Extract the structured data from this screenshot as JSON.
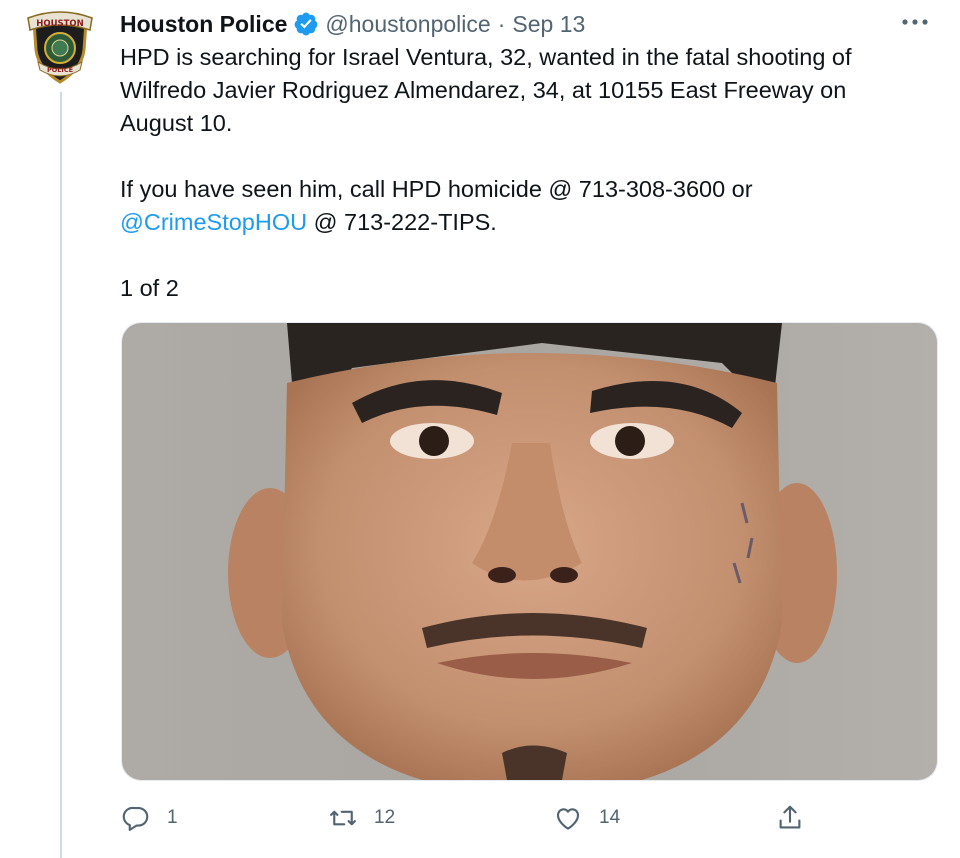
{
  "account": {
    "display_name": "Houston Police",
    "handle": "@houstonpolice",
    "separator": "·",
    "date": "Sep 13",
    "avatar_badge_top": "HOUSTON",
    "avatar_badge_bottom": "POLICE"
  },
  "tweet": {
    "line_1": "HPD is searching for Israel Ventura, 32, wanted in the fatal shooting of",
    "line_2": "Wilfredo Javier Rodriguez Almendarez, 34, at 10155 East Freeway on",
    "line_3": "August 10.",
    "line_4_prefix": "If you have seen him, call HPD homicide @ 713-308-3600 or",
    "mention": "@CrimeStopHOU",
    "line_5_suffix": " @ 713-222-TIPS.",
    "thread_counter": "1 of 2"
  },
  "actions": {
    "reply_count": "1",
    "retweet_count": "12",
    "like_count": "14"
  },
  "icons": {
    "verified": "verified-badge-icon",
    "more": "more-options-icon",
    "reply": "reply-icon",
    "retweet": "retweet-icon",
    "like": "heart-icon",
    "share": "share-icon"
  },
  "colors": {
    "text": "#0f1419",
    "secondary_text": "#536471",
    "link": "#1d9bf0",
    "verified": "#1d9bf0",
    "thread_line": "#cfd9de"
  }
}
